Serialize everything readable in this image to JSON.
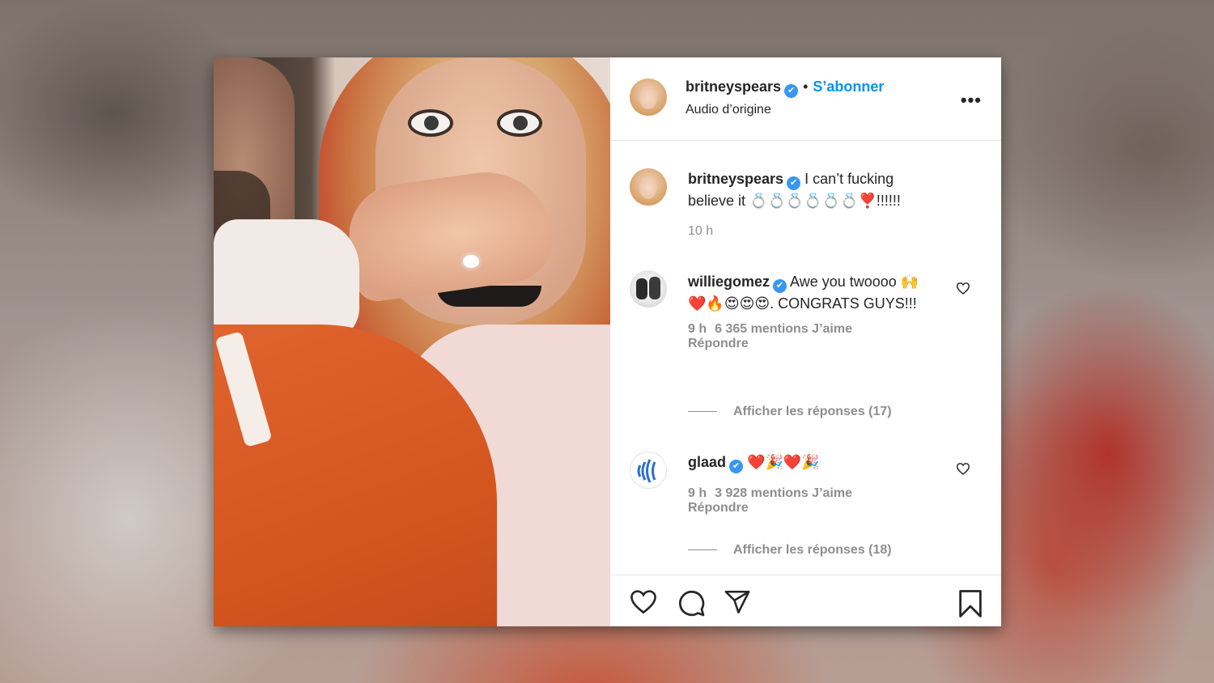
{
  "post": {
    "author": "britneyspears",
    "follow_label": "S’abonner",
    "separator": "•",
    "audio": "Audio d’origine",
    "more_label": "•••",
    "caption_text": "I can’t fucking believe it 💍💍💍💍💍💍❣️!!!!!!",
    "caption_time": "10 h"
  },
  "comments": [
    {
      "username": "williegomez",
      "text": "Awe you twoooo 🙌❤️🔥😍😍😍. CONGRATS GUYS!!!",
      "time": "9 h",
      "likes": "6 365 mentions J’aime",
      "reply": "Répondre",
      "show_replies": "Afficher les réponses (17)"
    },
    {
      "username": "glaad",
      "text": "❤️🎉❤️🎉",
      "time": "9 h",
      "likes": "3 928 mentions J’aime",
      "reply": "Répondre",
      "show_replies": "Afficher les réponses (18)"
    }
  ],
  "icons": {
    "like": "heart-icon",
    "comment": "comment-icon",
    "share": "send-icon",
    "save": "bookmark-icon",
    "verified": "verified-icon"
  },
  "colors": {
    "accent": "#0095f6",
    "verified": "#3897f0",
    "text": "#262626",
    "muted": "#8e8e8e"
  }
}
